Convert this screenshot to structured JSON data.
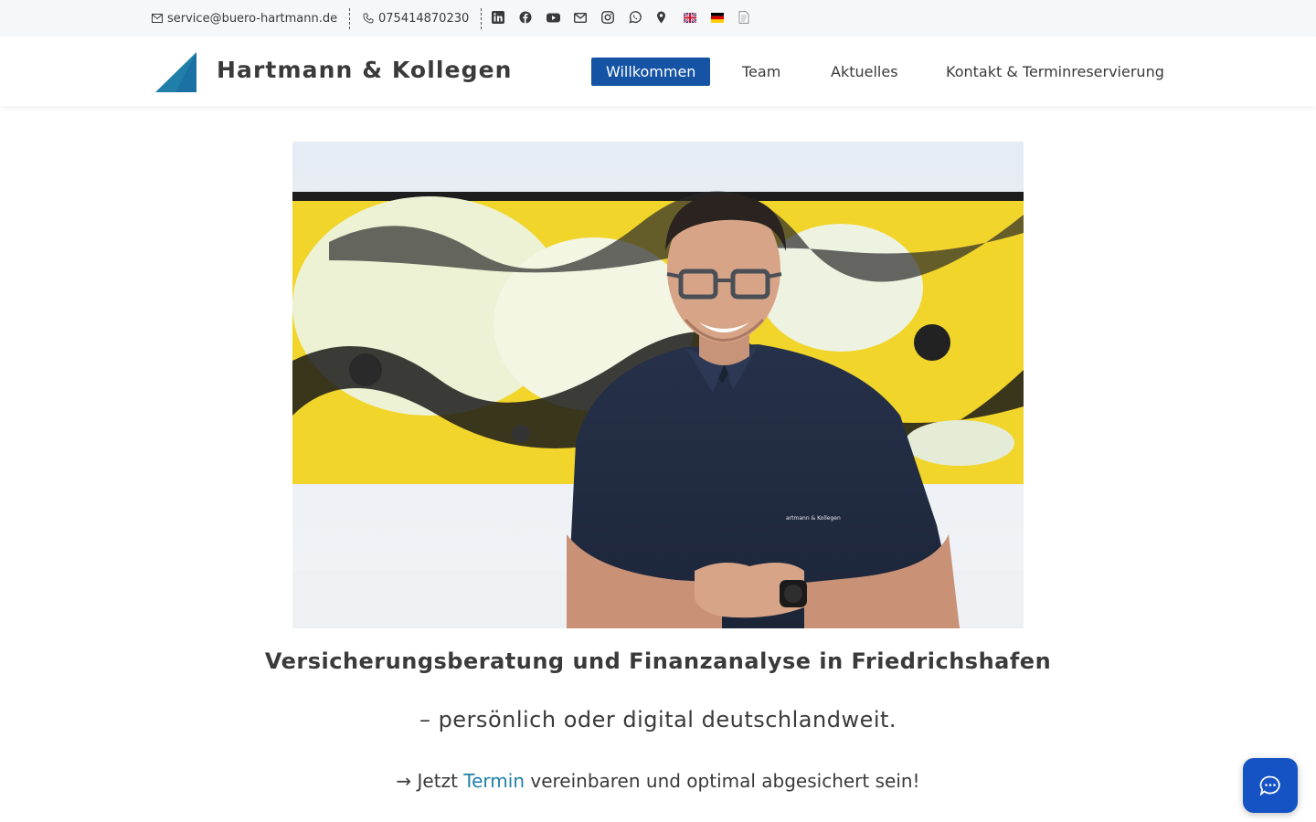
{
  "topbar": {
    "email": "service@buero-hartmann.de",
    "phone": "075414870230",
    "icons": [
      "linkedin-icon",
      "facebook-icon",
      "youtube-icon",
      "mail-icon",
      "instagram-icon",
      "whatsapp-icon",
      "map-pin-icon",
      "flag-uk-icon",
      "flag-de-icon",
      "document-icon"
    ]
  },
  "header": {
    "brand": "Hartmann & Kollegen",
    "nav": {
      "willkommen": "Willkommen",
      "team": "Team",
      "aktuelles": "Aktuelles",
      "kontakt": "Kontakt & Terminreservierung"
    },
    "active": "Willkommen"
  },
  "hero": {
    "shirt_text": "artmann & Kollegen"
  },
  "main": {
    "headline": "Versicherungsberatung und Finanzanalyse in Friedrichshafen",
    "subline": "– persönlich oder digital deutschlandweit.",
    "cta_prefix": "→ Jetzt ",
    "cta_link": "Termin",
    "cta_suffix": " vereinbaren und optimal abgesichert sein!"
  },
  "colors": {
    "accent": "#1553a4",
    "link": "#1f7fa8",
    "logo": "#1f7fa8",
    "chat": "#1553c4"
  }
}
